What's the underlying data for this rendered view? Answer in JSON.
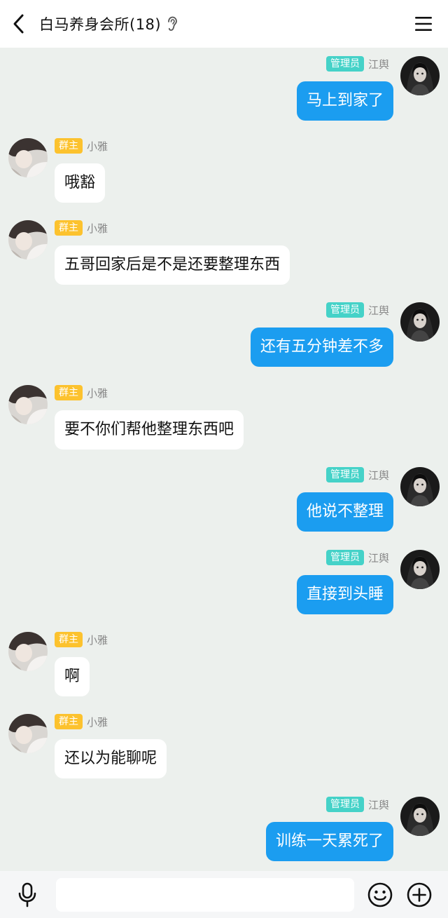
{
  "header": {
    "title": "白马养身会所(18)",
    "back_icon": "chevron-left-icon",
    "ear_icon": "ear-icon",
    "menu_icon": "hamburger-menu-icon"
  },
  "messages": [
    {
      "side": "right",
      "badge": "管理员",
      "name": "江舆",
      "text": "马上到家了"
    },
    {
      "side": "left",
      "badge": "群主",
      "name": "小雅",
      "text": "哦豁"
    },
    {
      "side": "left",
      "badge": "群主",
      "name": "小雅",
      "text": "五哥回家后是不是还要整理东西"
    },
    {
      "side": "right",
      "badge": "管理员",
      "name": "江舆",
      "text": "还有五分钟差不多"
    },
    {
      "side": "left",
      "badge": "群主",
      "name": "小雅",
      "text": "要不你们帮他整理东西吧"
    },
    {
      "side": "right",
      "badge": "管理员",
      "name": "江舆",
      "text": "他说不整理"
    },
    {
      "side": "right",
      "badge": "管理员",
      "name": "江舆",
      "text": "直接到头睡"
    },
    {
      "side": "left",
      "badge": "群主",
      "name": "小雅",
      "text": "啊"
    },
    {
      "side": "left",
      "badge": "群主",
      "name": "小雅",
      "text": "还以为能聊呢"
    },
    {
      "side": "right",
      "badge": "管理员",
      "name": "江舆",
      "text": "训练一天累死了"
    }
  ],
  "input": {
    "value": "",
    "mic_icon": "microphone-icon",
    "emoji_icon": "smiley-icon",
    "plus_icon": "plus-circle-icon"
  },
  "colors": {
    "chat_bg": "#ecf0ed",
    "outgoing_bubble": "#1b9df0",
    "owner_badge": "#fcc22e",
    "admin_badge": "#45d2c8"
  }
}
